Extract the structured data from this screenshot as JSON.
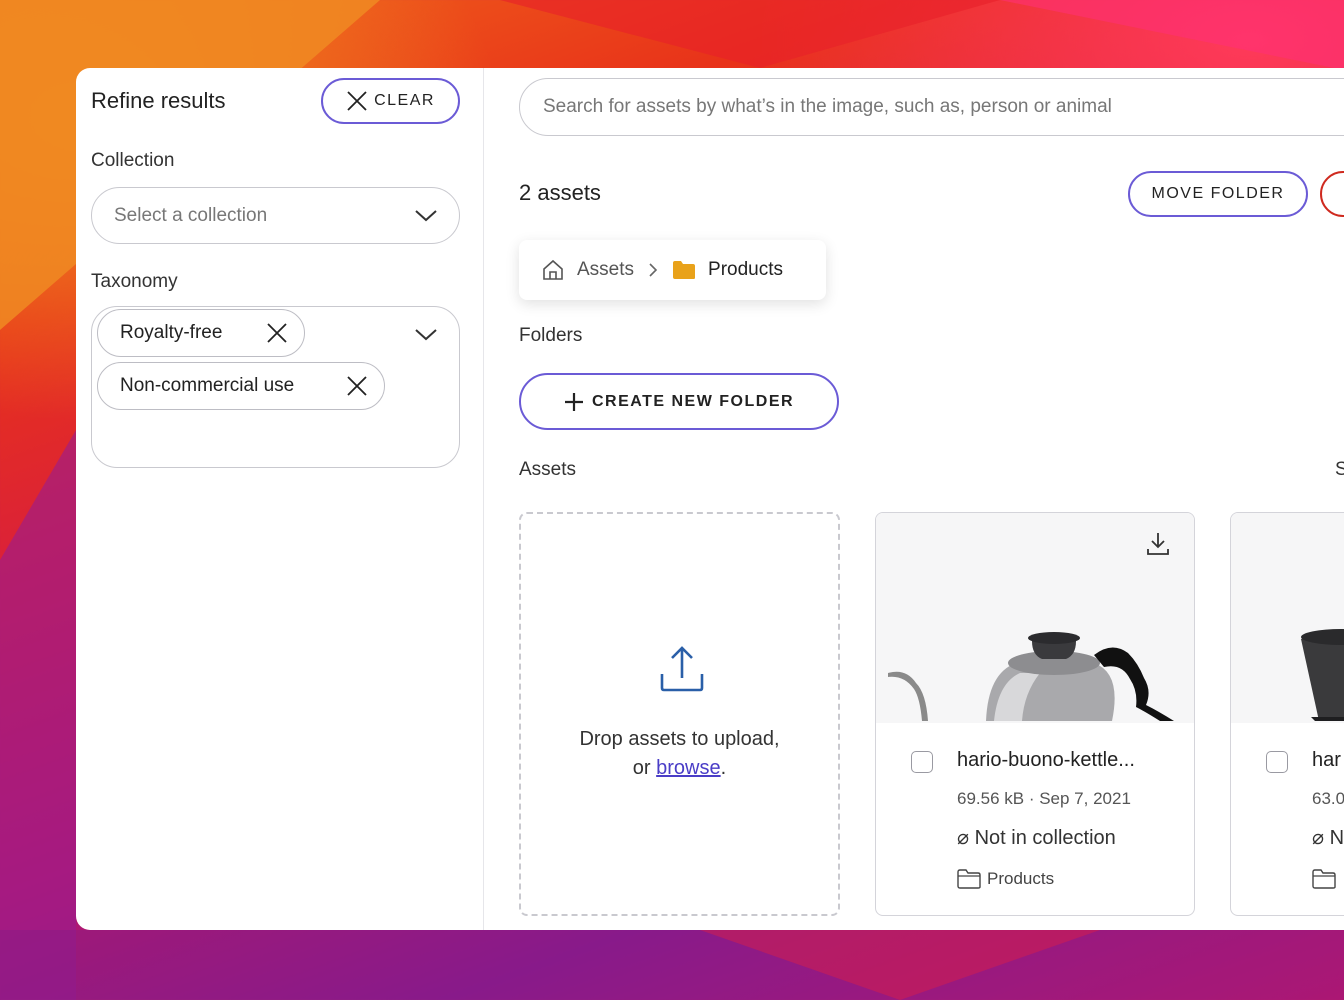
{
  "sidebar": {
    "title": "Refine results",
    "clear_label": "CLEAR",
    "collection_label": "Collection",
    "collection_placeholder": "Select a collection",
    "taxonomy_label": "Taxonomy",
    "taxonomy_chips": [
      "Royalty-free",
      "Non-commercial use"
    ]
  },
  "main": {
    "search_placeholder": "Search for assets by what’s in the image, such as, person or animal",
    "asset_count": "2 assets",
    "move_folder_label": "MOVE FOLDER",
    "breadcrumb": {
      "root": "Assets",
      "current": "Products"
    },
    "folders_heading": "Folders",
    "create_folder_label": "CREATE NEW FOLDER",
    "assets_heading": "Assets",
    "assets_heading_cut": "S",
    "drop": {
      "line1": "Drop assets to upload,",
      "or": "or ",
      "link": "browse",
      "period": "."
    },
    "cards": [
      {
        "name": "hario-buono-kettle...",
        "meta": "69.56 kB · Sep 7, 2021",
        "collection": "⌀ Not in collection",
        "folder": "Products"
      },
      {
        "name": "har",
        "meta": "63.0",
        "collection": "⌀ N",
        "folder": ""
      }
    ]
  },
  "colors": {
    "accent": "#6b5bd6",
    "danger": "#cf2a1f",
    "folder": "#e9a21a",
    "link": "#4a3dc7"
  }
}
